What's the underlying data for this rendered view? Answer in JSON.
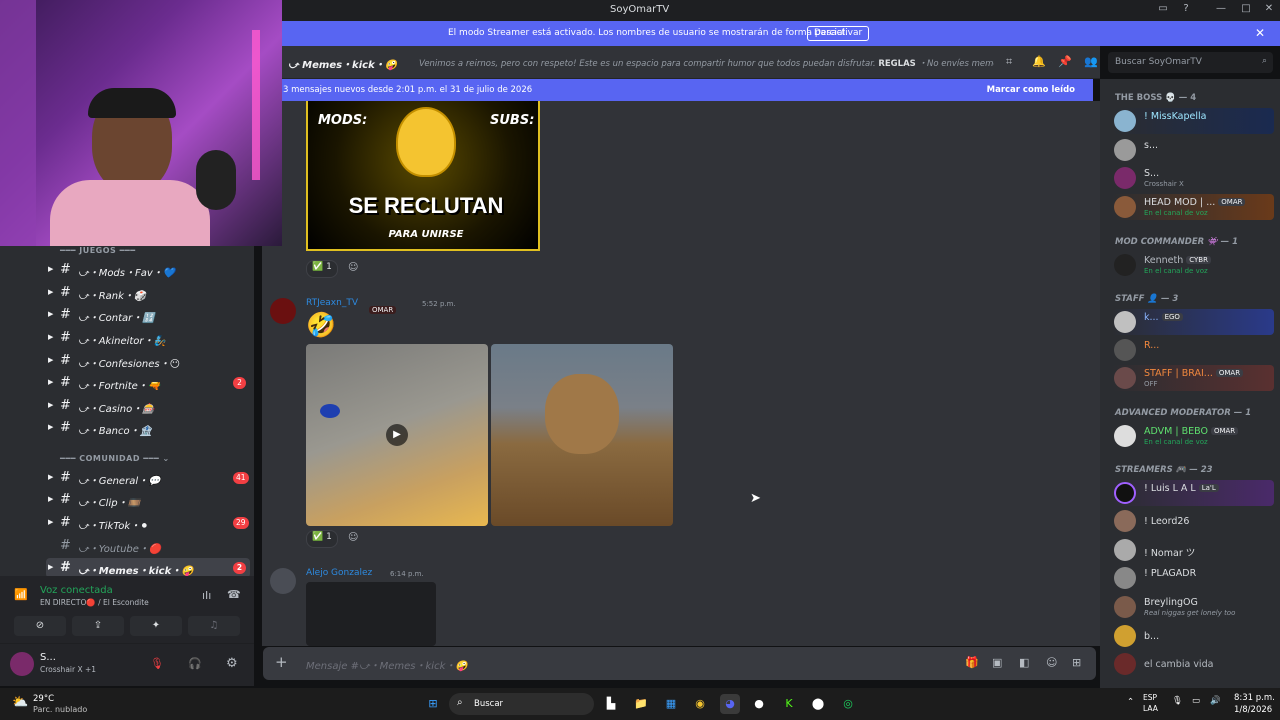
{
  "window": {
    "title": "SoyOmarTV"
  },
  "streamer_banner": {
    "message": "El modo Streamer está activado. Los nombres de usuario se mostrarán de forma parcial.",
    "button": "Desactivar"
  },
  "channel_header": {
    "name": "⤻ Memes・kick・🤪",
    "topic": "Venimos a reirnos, pero con respeto! Este es un espacio para compartir humor que todos puedan disfrutar.",
    "topic_rules": "REGLAS",
    "topic_rest": "・No envíes memes que ..."
  },
  "search": {
    "placeholder": "Buscar SoyOmarTV"
  },
  "new_messages": {
    "text": "3 mensajes nuevos desde 2:01 p.m. el 31 de julio de 2026",
    "mark_read": "Marcar como leído"
  },
  "categories": [
    {
      "label": "JUEGOS",
      "channels": [
        {
          "name": "⤻・Mods・Fav・💙",
          "badge": "",
          "unread": true
        },
        {
          "name": "⤻・Rank・🎲",
          "badge": "",
          "unread": true
        },
        {
          "name": "⤻・Contar・🔢",
          "badge": "",
          "unread": true
        },
        {
          "name": "⤻・Akineitor・🧞",
          "badge": "",
          "unread": true
        },
        {
          "name": "⤻・Confesiones・😶",
          "badge": "",
          "unread": true
        },
        {
          "name": "⤻・Fortnite・🔫",
          "badge": "2",
          "unread": true
        },
        {
          "name": "⤻・Casino・🎰",
          "badge": "",
          "unread": true
        },
        {
          "name": "⤻・Banco・🏦",
          "badge": "",
          "unread": true
        }
      ]
    },
    {
      "label": "COMUNIDAD",
      "channels": [
        {
          "name": "⤻・General・💬",
          "badge": "41",
          "unread": true
        },
        {
          "name": "⤻・Clip・🎞️",
          "badge": "",
          "unread": true
        },
        {
          "name": "⤻・TikTok・⚫",
          "badge": "29",
          "unread": true
        },
        {
          "name": "⤻・Youtube・🔴",
          "badge": "",
          "unread": false
        },
        {
          "name": "⤻・Memes・kick・🤪",
          "badge": "2",
          "unread": true
        }
      ]
    }
  ],
  "voice": {
    "status": "Voz conectada",
    "sub": "EN DIRECTO🔴 / El Escondite"
  },
  "user": {
    "name": "S...",
    "status": "Crosshair X +1"
  },
  "messages": [
    {
      "poster_top": "MODS:",
      "poster_top2": "SUBS:",
      "poster_text": "SE RECLUTAN",
      "poster_sub": "PARA UNIRSE",
      "reaction": "✅",
      "reaction_count": "1"
    },
    {
      "author": "RTJeaxn_TV",
      "tag": "OMAR",
      "time": "5:52 p.m.",
      "emoji": "🤣",
      "reaction": "✅",
      "reaction_count": "1"
    },
    {
      "author": "Alejo Gonzalez",
      "time": "6:14 p.m."
    }
  ],
  "composer": {
    "placeholder": "Mensaje #⤻・Memes・kick・🤪"
  },
  "members": {
    "roles": [
      {
        "name": "THE BOSS 💀 — 4"
      },
      {
        "name": "MOD COMMANDER 👾 — 1"
      },
      {
        "name": "STAFF 👤 — 3"
      },
      {
        "name": "ADVANCED MODERATOR — 1"
      },
      {
        "name": "STREAMERS 🎮 — 23"
      }
    ],
    "list": [
      {
        "name": "! MissKapella",
        "status": "",
        "tag": "",
        "color": "#9ee6ff"
      },
      {
        "name": "s...",
        "status": "",
        "tag": "",
        "color": "#dbdee1"
      },
      {
        "name": "S...",
        "status": "Crosshair X",
        "tag": "",
        "color": "#f2f3f5"
      },
      {
        "name": "HEAD MOD | ...",
        "status": "En el canal de voz",
        "tag": "OMAR",
        "color": "#f2f3f5"
      },
      {
        "name": "Kenneth",
        "status": "En el canal de voz",
        "tag": "CYBR",
        "color": "#b5bac1"
      },
      {
        "name": "k...",
        "status": "",
        "tag": "EGO",
        "color": "#8ab4ff"
      },
      {
        "name": "R...",
        "status": "",
        "tag": "",
        "color": "#f0883e"
      },
      {
        "name": "STAFF | BRAI...",
        "status": "OFF",
        "tag": "OMAR",
        "color": "#f0883e"
      },
      {
        "name": "ADVM | BEBO",
        "status": "En el canal de voz",
        "tag": "OMAR",
        "color": "#5fe06f"
      },
      {
        "name": "! Luis L A L",
        "status": "",
        "tag": "La'L",
        "color": "#f2f3f5"
      },
      {
        "name": "! Leord26",
        "status": "",
        "tag": "",
        "color": "#f2f3f5"
      },
      {
        "name": "! Nomar ツ",
        "status": "",
        "tag": "",
        "color": "#f2f3f5"
      },
      {
        "name": "! PLAGADR",
        "status": "",
        "tag": "",
        "color": "#f2f3f5"
      },
      {
        "name": "BreylingOG",
        "status": "Real niggas get lonely too",
        "tag": "",
        "color": "#f2f3f5"
      },
      {
        "name": "b...",
        "status": "",
        "tag": "",
        "color": "#f2f3f5"
      },
      {
        "name": "el cambia vida",
        "status": "",
        "tag": "",
        "color": "#b5bac1"
      }
    ]
  },
  "taskbar": {
    "weather_temp": "29°C",
    "weather_desc": "Parc. nublado",
    "search": "Buscar",
    "lang": "ESP",
    "lang2": "LAA",
    "time": "8:31 p.m.",
    "date": "1/8/2026"
  }
}
